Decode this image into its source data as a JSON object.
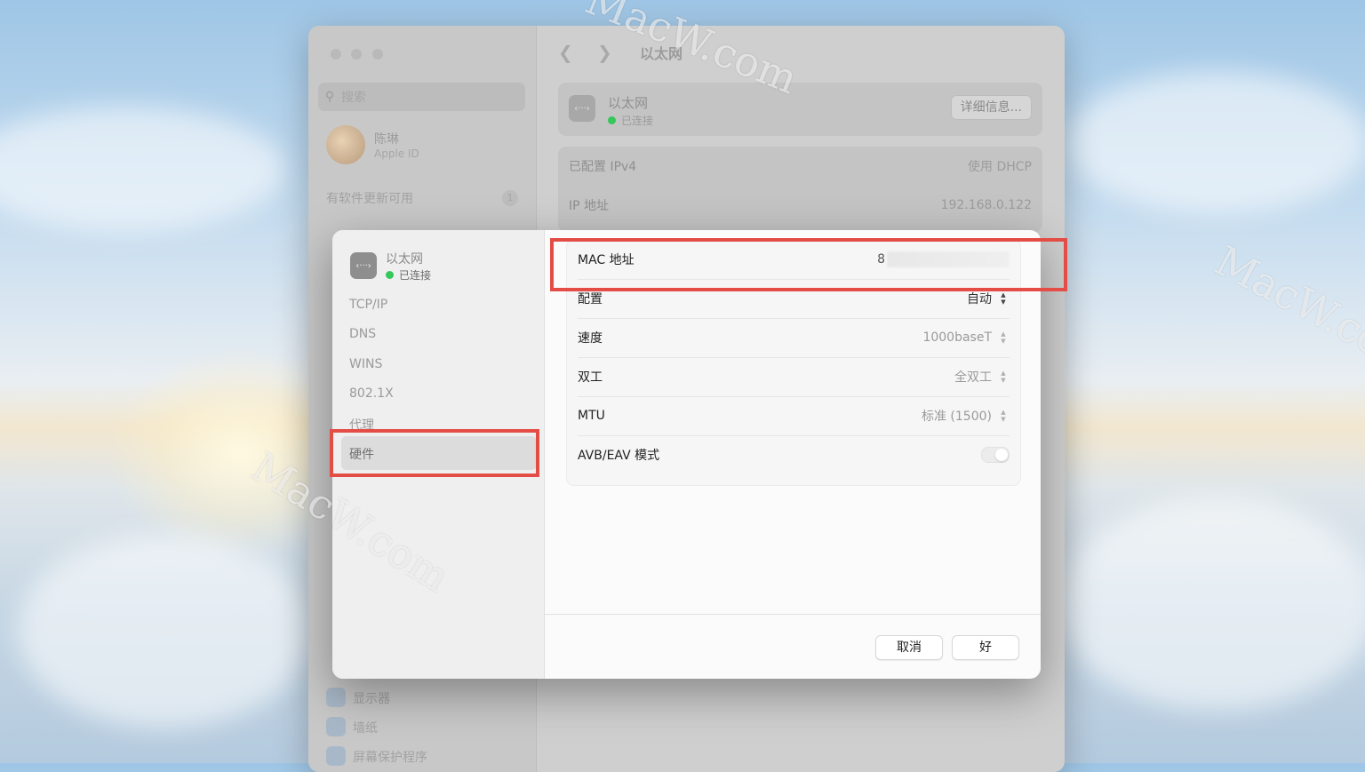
{
  "window": {
    "title": "以太网",
    "search_placeholder": "搜索",
    "account": {
      "name": "陈琳",
      "subtitle": "Apple ID"
    },
    "update_notice": {
      "label": "有软件更新可用",
      "badge": "1"
    },
    "sidebar_items": [
      "显示器",
      "墙纸",
      "屏幕保护程序"
    ],
    "ethernet_card": {
      "name": "以太网",
      "status": "已连接",
      "details_button": "详细信息..."
    },
    "ip_rows": [
      {
        "label": "已配置 IPv4",
        "value": "使用 DHCP"
      },
      {
        "label": "IP 地址",
        "value": "192.168.0.122"
      }
    ]
  },
  "dialog": {
    "service": {
      "name": "以太网",
      "status": "已连接"
    },
    "tabs": [
      "TCP/IP",
      "DNS",
      "WINS",
      "802.1X",
      "代理",
      "硬件"
    ],
    "selected_tab": "硬件",
    "rows": {
      "mac": {
        "label": "MAC 地址",
        "value": "8"
      },
      "config": {
        "label": "配置",
        "value": "自动"
      },
      "speed": {
        "label": "速度",
        "value": "1000baseT"
      },
      "duplex": {
        "label": "双工",
        "value": "全双工"
      },
      "mtu": {
        "label": "MTU",
        "value": "标准 (1500)"
      },
      "avb": {
        "label": "AVB/EAV 模式",
        "enabled": false
      }
    },
    "buttons": {
      "cancel": "取消",
      "ok": "好"
    }
  },
  "watermark": "MacW.com",
  "colors": {
    "highlight": "#e34d45",
    "status_green": "#34c759"
  }
}
